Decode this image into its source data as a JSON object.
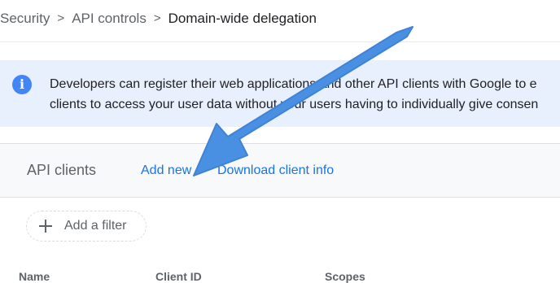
{
  "breadcrumb": {
    "items": [
      "Security",
      "API controls"
    ],
    "current": "Domain-wide delegation",
    "separator": ">"
  },
  "info_banner": {
    "icon": "info-icon",
    "icon_glyph": "i",
    "line1": "Developers can register their web applications and other API clients with Google to e",
    "line2": "clients to access your user data without your users having to individually give consen"
  },
  "api_clients": {
    "title": "API clients",
    "add_new": "Add new",
    "download_client_info": "Download client info",
    "filter": {
      "icon": "plus-icon",
      "label": "Add a filter"
    },
    "columns": [
      "Name",
      "Client ID",
      "Scopes"
    ]
  },
  "annotation": {
    "icon": "arrow-annotation",
    "color": "#4a90e2"
  },
  "colors": {
    "accent": "#1a73e8",
    "banner_bg": "#e8f0fe",
    "info_icon": "#4285f4"
  }
}
